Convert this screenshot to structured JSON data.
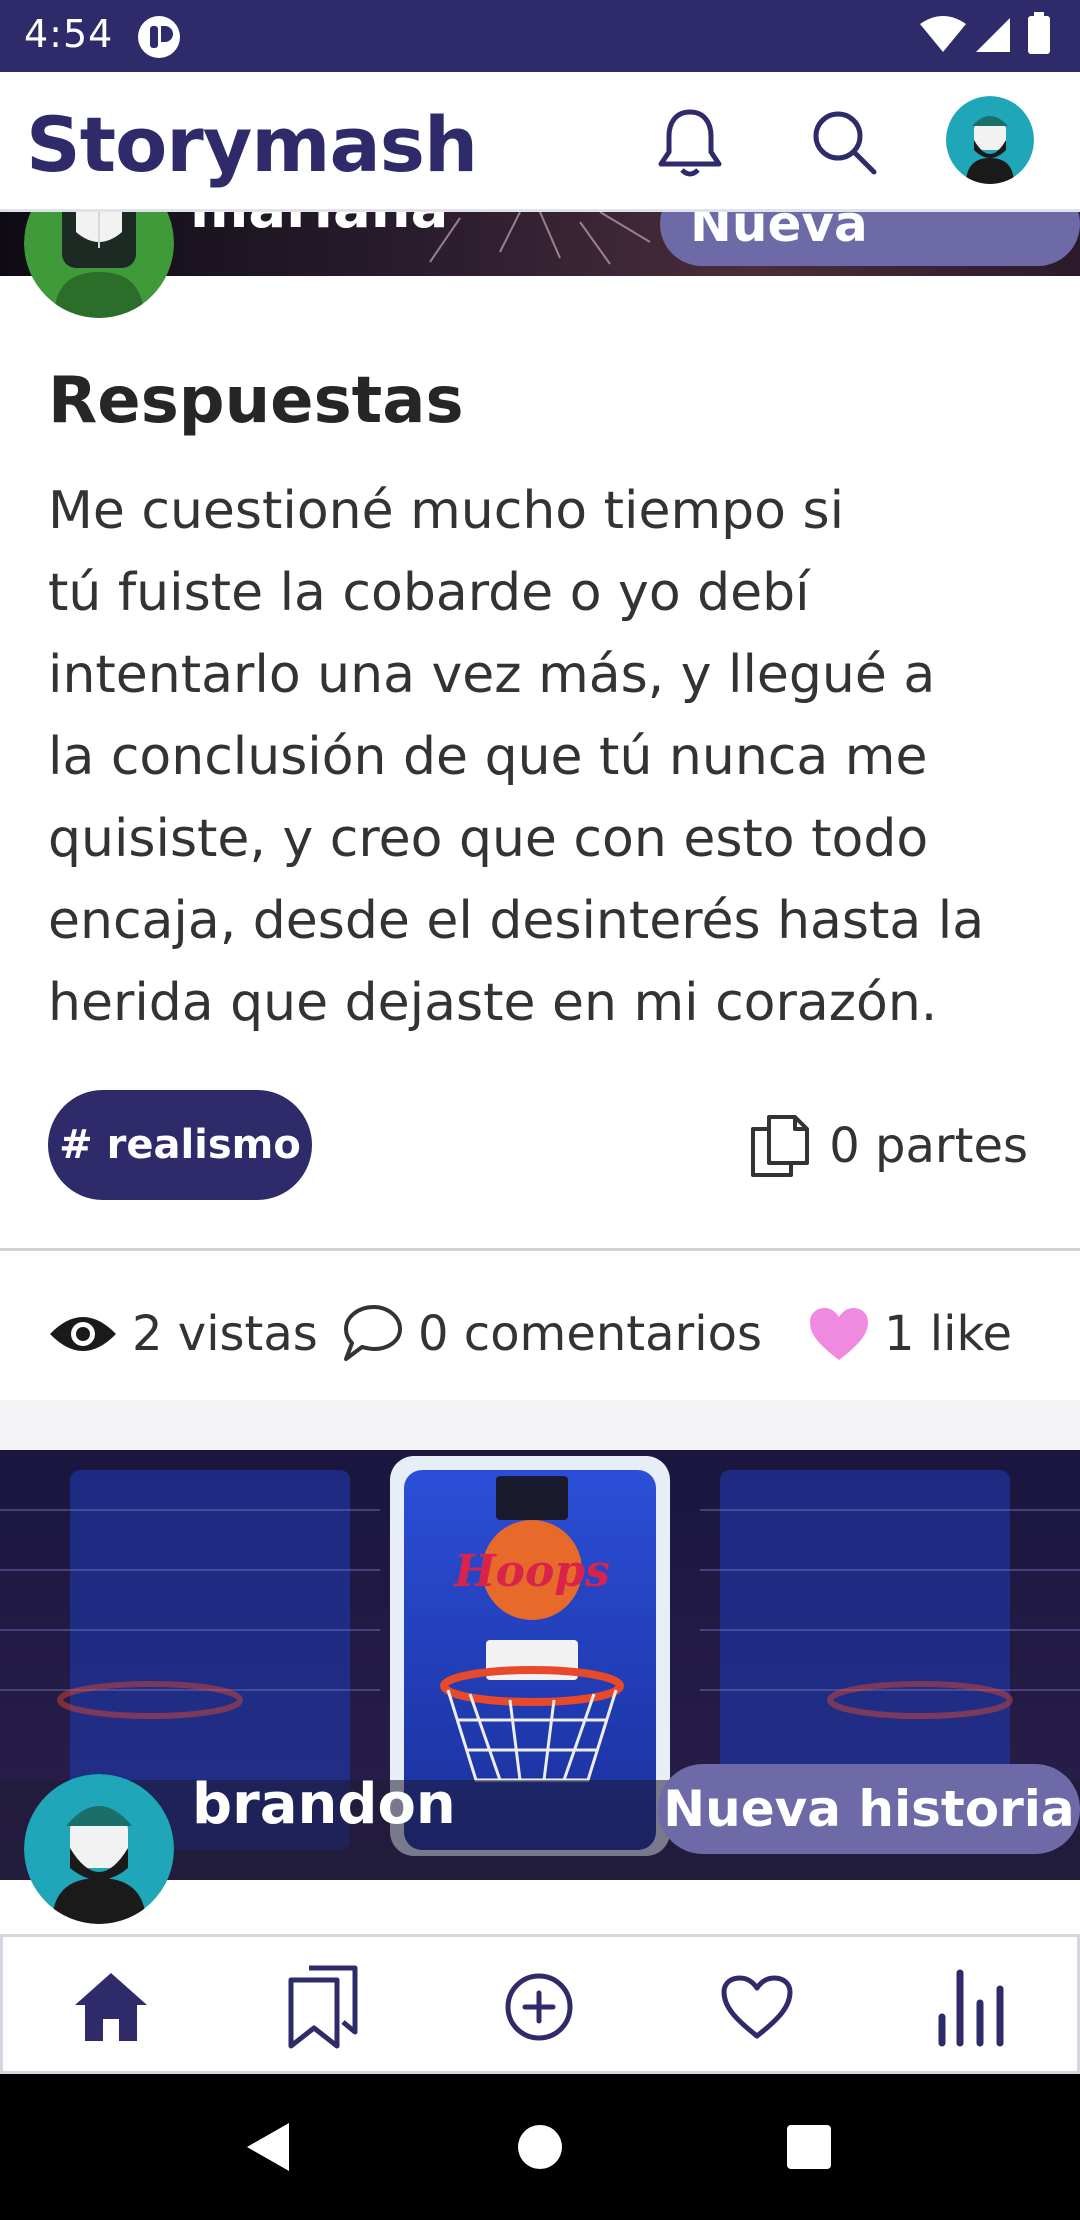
{
  "status_bar": {
    "time": "4:54"
  },
  "header": {
    "app_name": "Storymash",
    "icons": [
      "bell-icon",
      "search-icon",
      "profile-avatar"
    ]
  },
  "feed": {
    "card_1": {
      "author_partial": "mariana",
      "new_story_label_partial": "Nueva historia",
      "title": "Respuestas",
      "body_lines": [
        "Me cuestioné mucho tiempo si",
        "tú fuiste la cobarde o yo debí",
        "intentarlo una vez más, y llegué a",
        "la conclusión de que tú nunca me",
        "quisiste, y creo que con esto todo",
        "encaja, desde el desinterés hasta la",
        "herida que dejaste en mi corazón."
      ],
      "tag": "# realismo",
      "parts": "0 partes",
      "views": "2 vistas",
      "comments": "0 comentarios",
      "likes": "1 like"
    },
    "card_2": {
      "author": "brandon",
      "new_story_label": "Nueva historia",
      "banner_text": "Hoops"
    }
  },
  "bottom_nav": {
    "items": [
      "home-icon",
      "bookmarks-icon",
      "add-circle-icon",
      "heart-icon",
      "stats-icon"
    ]
  },
  "colors": {
    "primary": "#2f2b6b",
    "pill": "#6e6aa8",
    "like": "#f08ae0"
  }
}
